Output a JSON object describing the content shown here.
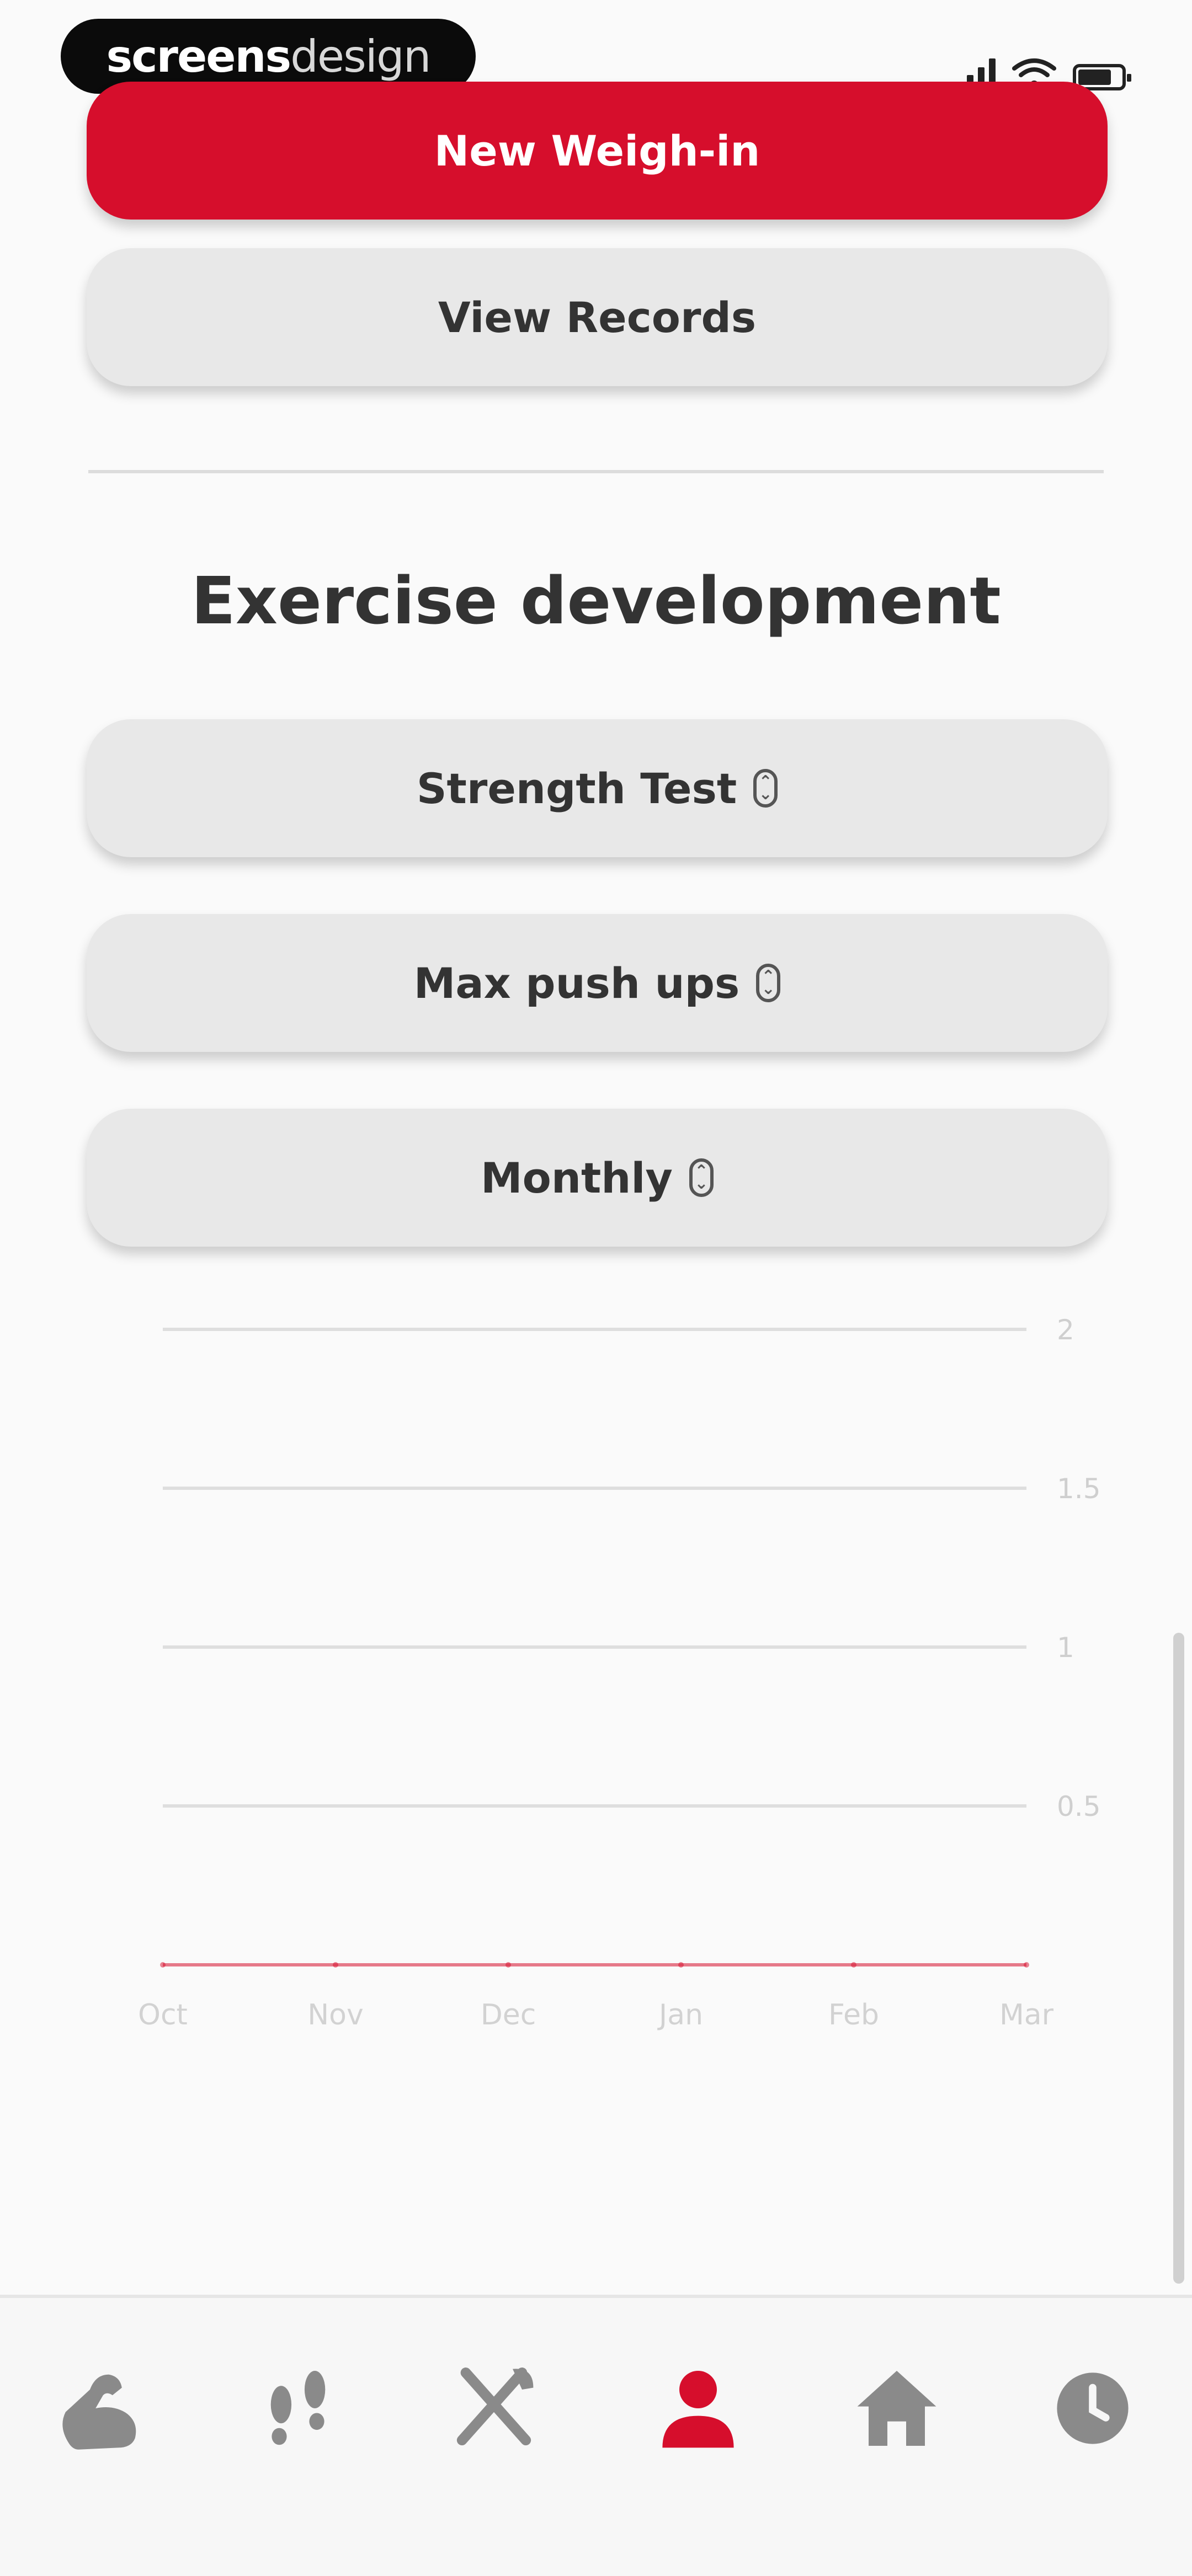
{
  "watermark": {
    "bold": "screens",
    "light": "design"
  },
  "buttons": {
    "new_weigh_in": "New Weigh-in",
    "view_records": "View Records"
  },
  "section": {
    "title": "Exercise development"
  },
  "selectors": {
    "test_type": "Strength Test",
    "exercise": "Max push ups",
    "period": "Monthly"
  },
  "colors": {
    "accent": "#d60e2c",
    "button_gray": "#e8e8e8",
    "text_dark": "#333333",
    "nav_inactive": "#8a8a8a"
  },
  "chart_data": {
    "type": "line",
    "categories": [
      "Oct",
      "Nov",
      "Dec",
      "Jan",
      "Feb",
      "Mar"
    ],
    "y_ticks": [
      "2",
      "1.5",
      "1",
      "0.5"
    ],
    "series": [
      {
        "values": [
          0,
          0,
          0,
          0,
          0,
          0
        ],
        "color": "#d60e2c"
      }
    ],
    "ylim": [
      0,
      2
    ],
    "grid": true,
    "y_axis_side": "right"
  },
  "nav": {
    "items": [
      {
        "icon": "flexed-arm-icon",
        "active": false
      },
      {
        "icon": "footsteps-icon",
        "active": false
      },
      {
        "icon": "fork-knife-icon",
        "active": false
      },
      {
        "icon": "person-icon",
        "active": true
      },
      {
        "icon": "home-icon",
        "active": false
      },
      {
        "icon": "clock-icon",
        "active": false
      }
    ]
  }
}
